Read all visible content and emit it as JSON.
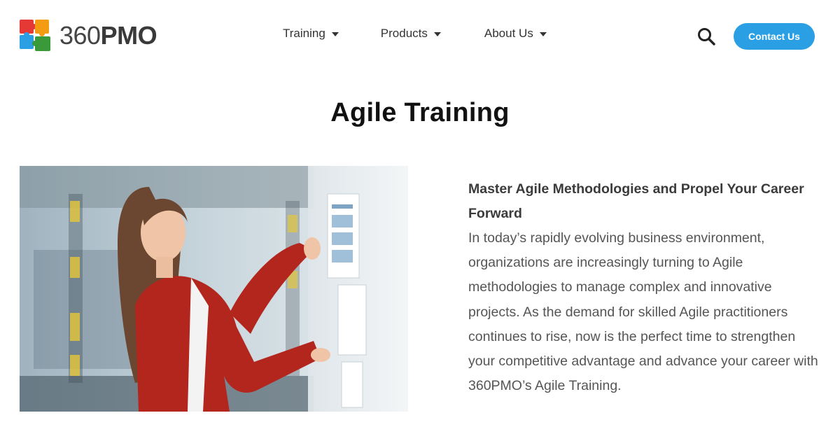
{
  "header": {
    "logo_light": "360",
    "logo_bold": "PMO",
    "nav": [
      {
        "label": "Training",
        "icon": "caret-down-icon"
      },
      {
        "label": "Products",
        "icon": "caret-down-icon"
      },
      {
        "label": "About Us",
        "icon": "caret-down-icon"
      }
    ],
    "search_icon": "search-icon",
    "contact_label": "Contact Us"
  },
  "main": {
    "title": "Agile Training",
    "lead": "Master Agile Methodologies and Propel Your Career Forward",
    "body": "In today’s rapidly evolving business environment, organizations are increasingly turning to Agile methodologies to manage complex and innovative projects. As the demand for skilled Agile practitioners continues to rise, now is the perfect time to strengthen your competitive advantage and advance your career with 360PMO’s Agile Training."
  },
  "colors": {
    "accent": "#2b9fe3",
    "logo_red": "#e53935",
    "logo_orange": "#f39c12",
    "logo_blue": "#2b9fe3",
    "logo_green": "#3a9a3a",
    "jacket": "#b3261e"
  }
}
